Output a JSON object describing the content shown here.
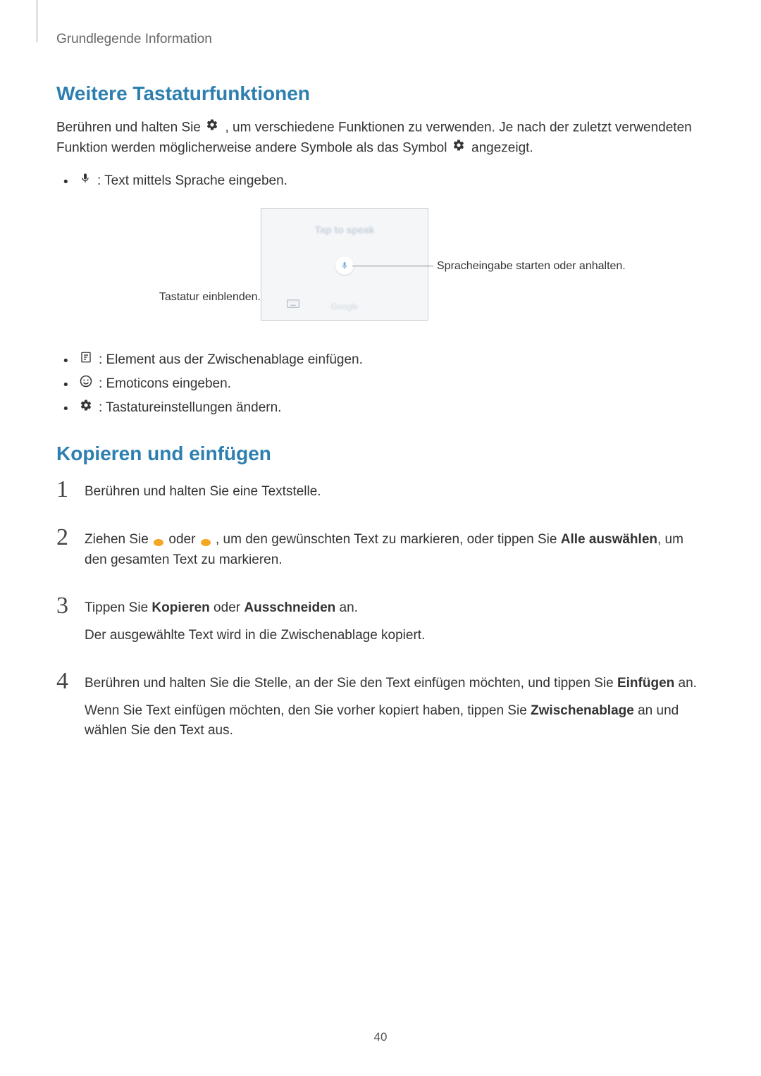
{
  "breadcrumb": "Grundlegende Information",
  "section1": {
    "title": "Weitere Tastaturfunktionen",
    "intro_p1a": "Berühren und halten Sie ",
    "intro_p1b": ", um verschiedene Funktionen zu verwenden. Je nach der zuletzt verwendeten Funktion werden möglicherweise andere Symbole als das Symbol ",
    "intro_p1c": " angezeigt.",
    "bullet_mic": " : Text mittels Sprache eingeben.",
    "diagram": {
      "tap_label": "Tap to speak",
      "google_label": "Google",
      "callout_left": "Tastatur einblenden.",
      "callout_right": "Spracheingabe starten oder anhalten."
    },
    "bullet_clip": " : Element aus der Zwischenablage einfügen.",
    "bullet_emoji": " : Emoticons eingeben.",
    "bullet_gear": " : Tastatureinstellungen ändern."
  },
  "section2": {
    "title": "Kopieren und einfügen",
    "steps": {
      "s1": "Berühren und halten Sie eine Textstelle.",
      "s2a": "Ziehen Sie ",
      "s2b": " oder ",
      "s2c": ", um den gewünschten Text zu markieren, oder tippen Sie ",
      "s2_bold1": "Alle auswählen",
      "s2d": ", um den gesamten Text zu markieren.",
      "s3a": "Tippen Sie ",
      "s3_bold1": "Kopieren",
      "s3b": " oder ",
      "s3_bold2": "Ausschneiden",
      "s3c": " an.",
      "s3_p2": "Der ausgewählte Text wird in die Zwischenablage kopiert.",
      "s4a": "Berühren und halten Sie die Stelle, an der Sie den Text einfügen möchten, und tippen Sie ",
      "s4_bold1": "Einfügen",
      "s4b": " an.",
      "s4_p2a": "Wenn Sie Text einfügen möchten, den Sie vorher kopiert haben, tippen Sie ",
      "s4_bold2": "Zwischenablage",
      "s4_p2b": " an und wählen Sie den Text aus."
    }
  },
  "page_number": "40"
}
